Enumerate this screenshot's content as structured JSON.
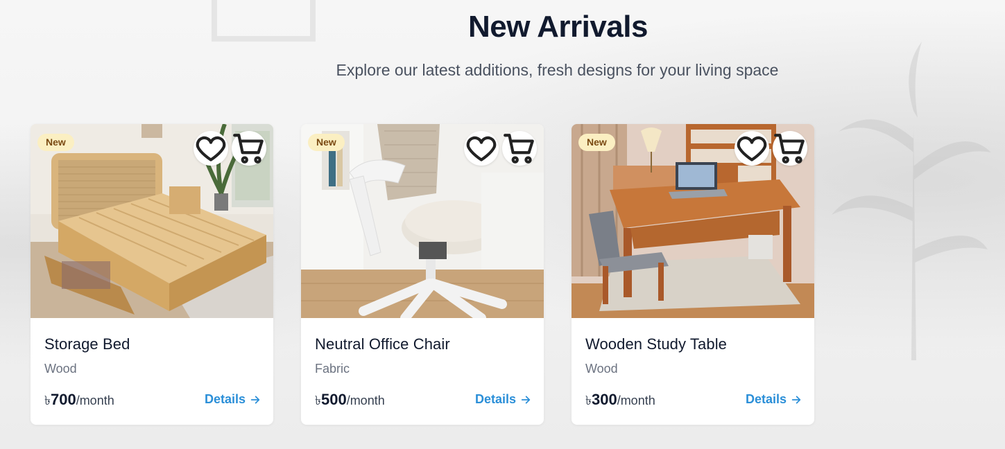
{
  "section": {
    "title": "New Arrivals",
    "subtitle": "Explore our latest additions, fresh designs for your living space"
  },
  "colors": {
    "accent": "#2b8fd8",
    "badge_bg": "#fbefc2",
    "badge_text": "#7a4a12",
    "heading": "#111a2e"
  },
  "products": [
    {
      "badge": "New",
      "name": "Storage Bed",
      "material": "Wood",
      "currency": "৳",
      "price": "700",
      "period": "/month",
      "details_label": "Details",
      "icons": [
        "heart-icon",
        "cart-icon",
        "arrow-right-icon"
      ]
    },
    {
      "badge": "New",
      "name": "Neutral Office Chair",
      "material": "Fabric",
      "currency": "৳",
      "price": "500",
      "period": "/month",
      "details_label": "Details",
      "icons": [
        "heart-icon",
        "cart-icon",
        "arrow-right-icon"
      ]
    },
    {
      "badge": "New",
      "name": "Wooden Study Table",
      "material": "Wood",
      "currency": "৳",
      "price": "300",
      "period": "/month",
      "details_label": "Details",
      "icons": [
        "heart-icon",
        "cart-icon",
        "arrow-right-icon"
      ]
    }
  ]
}
